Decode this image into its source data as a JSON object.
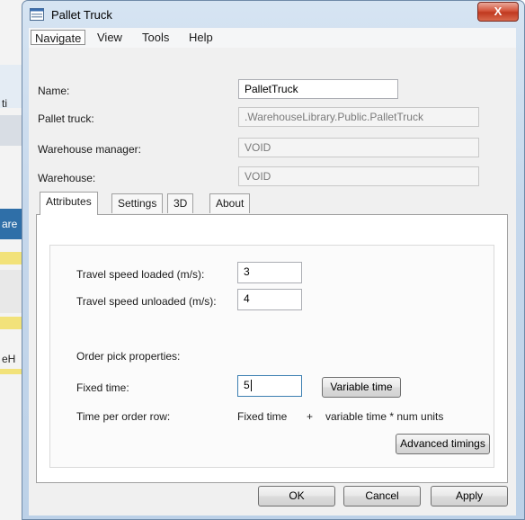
{
  "background_app": {
    "fragments": [
      "ti",
      "are",
      "eH"
    ]
  },
  "window": {
    "title": "Pallet Truck",
    "close_label": "X"
  },
  "menu": {
    "items": [
      "Navigate",
      "View",
      "Tools",
      "Help"
    ]
  },
  "form": {
    "name_label": "Name:",
    "name_value": "PalletTruck",
    "pallet_truck_label": "Pallet truck:",
    "pallet_truck_value": ".WarehouseLibrary.Public.PalletTruck",
    "warehouse_manager_label": "Warehouse manager:",
    "warehouse_manager_value": "VOID",
    "warehouse_label": "Warehouse:",
    "warehouse_value": "VOID"
  },
  "tabs": [
    "Attributes",
    "Settings",
    "3D",
    "About"
  ],
  "attributes": {
    "travel_loaded_label": "Travel speed loaded (m/s):",
    "travel_loaded_value": "3",
    "travel_unloaded_label": "Travel speed unloaded (m/s):",
    "travel_unloaded_value": "4",
    "order_pick_label": "Order pick properties:",
    "fixed_time_label": "Fixed time:",
    "fixed_time_value": "5",
    "variable_time_button": "Variable time",
    "time_per_order_row_label": "Time per order row:",
    "formula_fixed": "Fixed time",
    "formula_plus": "+",
    "formula_variable": "variable time * num units",
    "advanced_timings_button": "Advanced timings"
  },
  "footer": {
    "ok": "OK",
    "cancel": "Cancel",
    "apply": "Apply"
  },
  "colors": {
    "close_button": "#c0391f",
    "frame": "#c6d8ec",
    "focus_border": "#3c7fb1"
  }
}
